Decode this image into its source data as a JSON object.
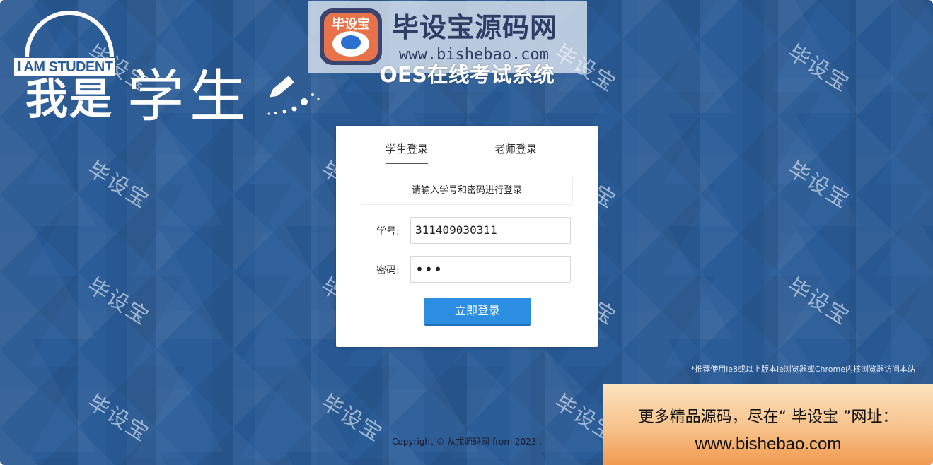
{
  "logo": {
    "tag": "I AM STUDENT",
    "text_part1": "我是",
    "text_part2": "学生"
  },
  "watermark_banner": {
    "badge": "毕设宝",
    "title": "毕设宝源码网",
    "url": "www.bishebao.com"
  },
  "system_title": "OES在线考试系统",
  "login": {
    "tabs": [
      {
        "label": "学生登录",
        "active": true
      },
      {
        "label": "老师登录",
        "active": false
      }
    ],
    "hint": "请输入学号和密码进行登录",
    "id_label": "学号:",
    "id_value": "311409030311",
    "pw_label": "密码:",
    "pw_value": "•••",
    "submit_label": "立即登录"
  },
  "browser_tip": "*推荐使用ie8或以上版本ie浏览器或Chrome内核浏览器访问本站",
  "copyright": "Copyright © 从戎源码网 from 2023 .",
  "ad": {
    "line1": "更多精品源码，尽在“ 毕设宝 ”网址：",
    "line2": "www.bishebao.com"
  },
  "watermark_text": "毕设宝",
  "colors": {
    "background": "#2a5c98",
    "button": "#2b8ee0",
    "card": "#ffffff"
  }
}
